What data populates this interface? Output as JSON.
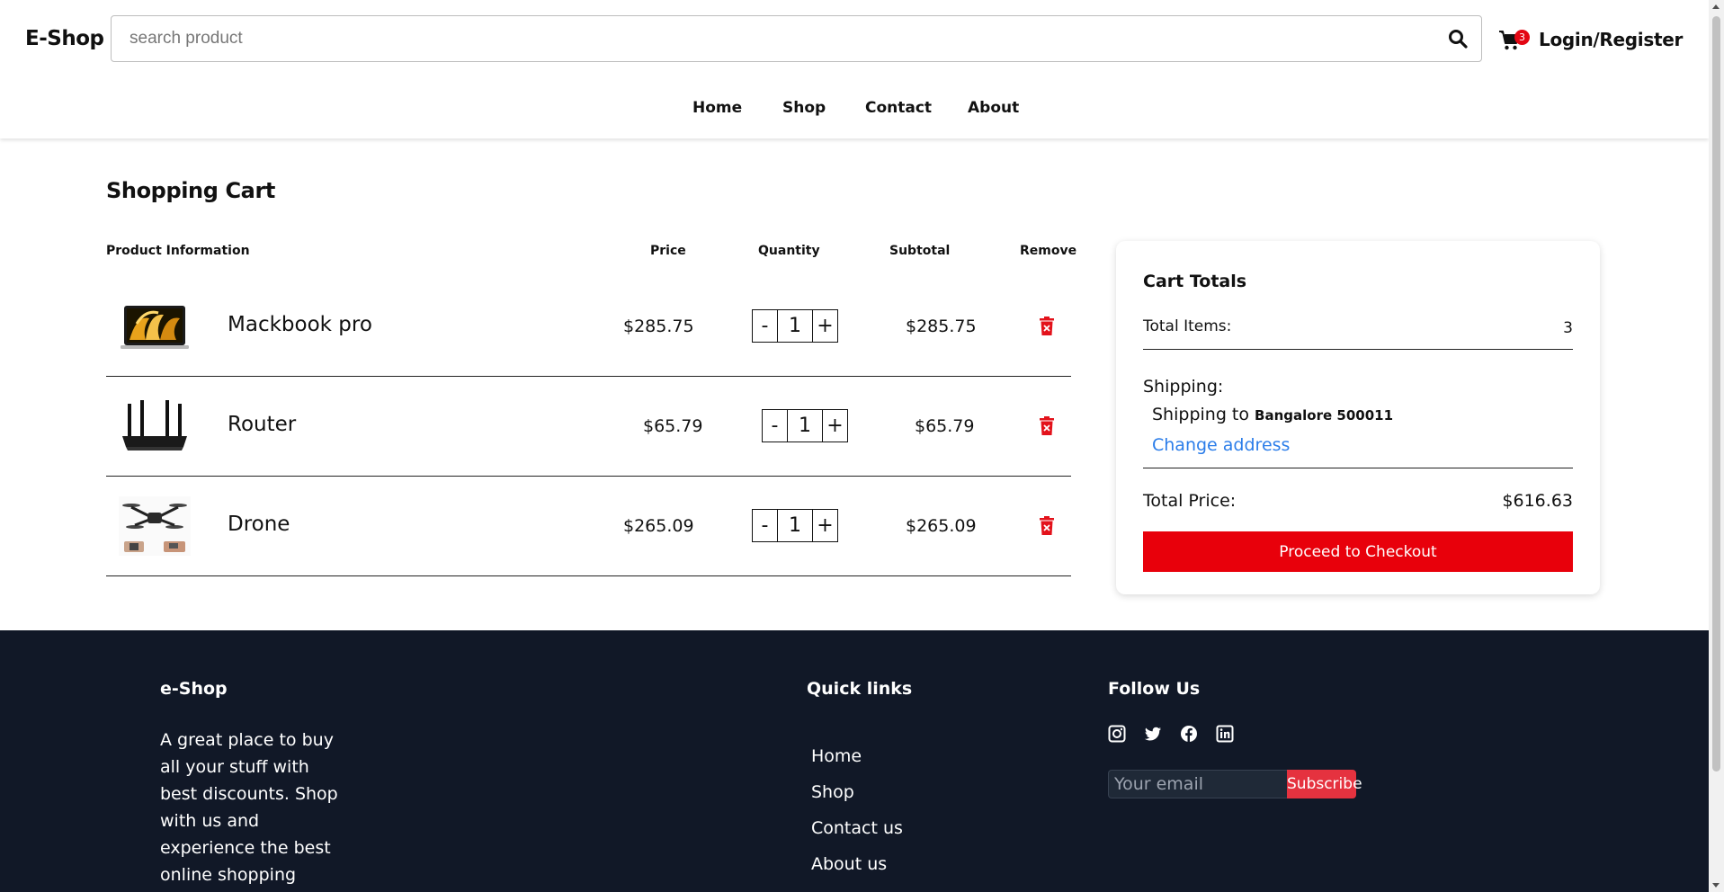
{
  "header": {
    "logo": "E-Shop",
    "search_placeholder": "search product",
    "cart_count": "3",
    "login_label": "Login/Register",
    "nav": [
      "Home",
      "Shop",
      "Contact",
      "About"
    ]
  },
  "cart": {
    "title": "Shopping Cart",
    "columns": {
      "product": "Product Information",
      "price": "Price",
      "quantity": "Quantity",
      "subtotal": "Subtotal",
      "remove": "Remove"
    },
    "items": [
      {
        "name": "Mackbook pro",
        "price": "$285.75",
        "qty": "1",
        "subtotal": "$285.75"
      },
      {
        "name": "Router",
        "price": "$65.79",
        "qty": "1",
        "subtotal": "$65.79"
      },
      {
        "name": "Drone",
        "price": "$265.09",
        "qty": "1",
        "subtotal": "$265.09"
      }
    ],
    "minus": "-",
    "plus": "+"
  },
  "totals": {
    "title": "Cart Totals",
    "items_label": "Total Items:",
    "items_value": "3",
    "shipping_label": "Shipping:",
    "shipping_to": "Shipping to",
    "shipping_address": "Bangalore 500011",
    "change_address": "Change address",
    "total_price_label": "Total Price:",
    "total_price_value": "$616.63",
    "checkout_label": "Proceed to Checkout"
  },
  "footer": {
    "brand": "e-Shop",
    "description": "A great place to buy all your stuff with best discounts. Shop with us and experience the best online shopping experience.",
    "quick_links_title": "Quick links",
    "quick_links": [
      "Home",
      "Shop",
      "Contact us",
      "About us"
    ],
    "follow_title": "Follow Us",
    "social_icons": [
      "instagram-icon",
      "twitter-icon",
      "facebook-icon",
      "linkedin-icon"
    ],
    "email_placeholder": "Your email",
    "subscribe_label": "Subscribe"
  },
  "colors": {
    "accent_red": "#e8000b",
    "link_blue": "#2b7de9",
    "footer_bg": "#111827"
  }
}
